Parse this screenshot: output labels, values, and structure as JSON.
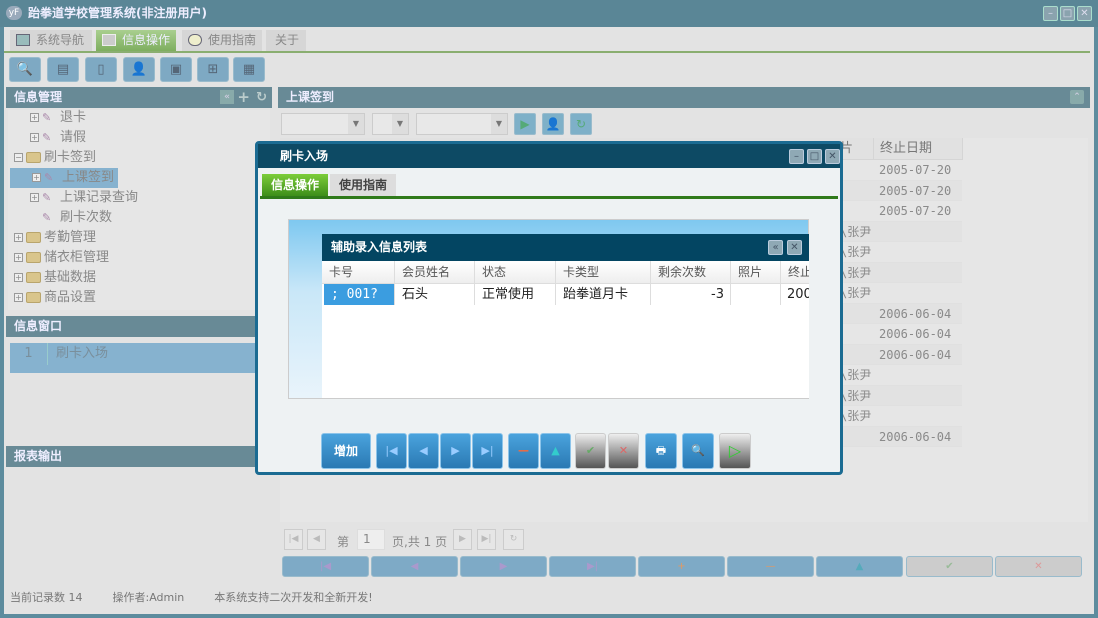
{
  "app": {
    "title": "跆拳道学校管理系统(非注册用户)",
    "logo": "yF"
  },
  "tabs": [
    {
      "label": "系统导航"
    },
    {
      "label": "信息操作"
    },
    {
      "label": "使用指南"
    },
    {
      "label": "关于"
    }
  ],
  "left": {
    "info_mgmt": "信息管理",
    "tree": [
      {
        "label": "退卡"
      },
      {
        "label": "请假"
      },
      {
        "label": "刷卡签到"
      },
      {
        "label": "上课签到"
      },
      {
        "label": "上课记录查询"
      },
      {
        "label": "刷卡次数"
      },
      {
        "label": "考勤管理"
      },
      {
        "label": "储衣柜管理"
      },
      {
        "label": "基础数据"
      },
      {
        "label": "商品设置"
      }
    ],
    "info_window": "信息窗口",
    "window_list": [
      {
        "num": "1",
        "label": "刷卡入场"
      }
    ],
    "report": "报表输出"
  },
  "right": {
    "title": "上课签到",
    "columns": [
      "片",
      "终止日期"
    ],
    "rows": [
      {
        "a": "",
        "b": "2005-07-20"
      },
      {
        "a": "",
        "b": "2005-07-20"
      },
      {
        "a": "",
        "b": "2005-07-20"
      },
      {
        "a": "\\张尹",
        "b": ""
      },
      {
        "a": "\\张尹",
        "b": ""
      },
      {
        "a": "\\张尹",
        "b": ""
      },
      {
        "a": "\\张尹",
        "b": ""
      },
      {
        "a": "",
        "b": "2006-06-04"
      },
      {
        "a": "",
        "b": "2006-06-04"
      },
      {
        "a": "",
        "b": "2006-06-04"
      },
      {
        "a": "\\张尹",
        "b": ""
      },
      {
        "a": "\\张尹",
        "b": ""
      },
      {
        "a": "\\张尹",
        "b": ""
      },
      {
        "a": "",
        "b": "2006-06-04"
      }
    ],
    "pager": {
      "prefix": "第",
      "page": "1",
      "suffix": "页,共 1 页"
    }
  },
  "status": {
    "records": "当前记录数 14",
    "operator": "操作者:Admin",
    "note": "本系统支持二次开发和全新开发!"
  },
  "modal": {
    "title": "刷卡入场",
    "tabs": [
      {
        "label": "信息操作"
      },
      {
        "label": "使用指南"
      }
    ],
    "list_title": "辅助录入信息列表",
    "columns": [
      "卡号",
      "会员姓名",
      "状态",
      "卡类型",
      "剩余次数",
      "照片",
      "终止"
    ],
    "row": {
      "card": "; 001?",
      "name": "石头",
      "state": "正常使用",
      "type": "跆拳道月卡",
      "remaining": "-3",
      "photo": "",
      "end": "200"
    },
    "add_label": "增加"
  }
}
